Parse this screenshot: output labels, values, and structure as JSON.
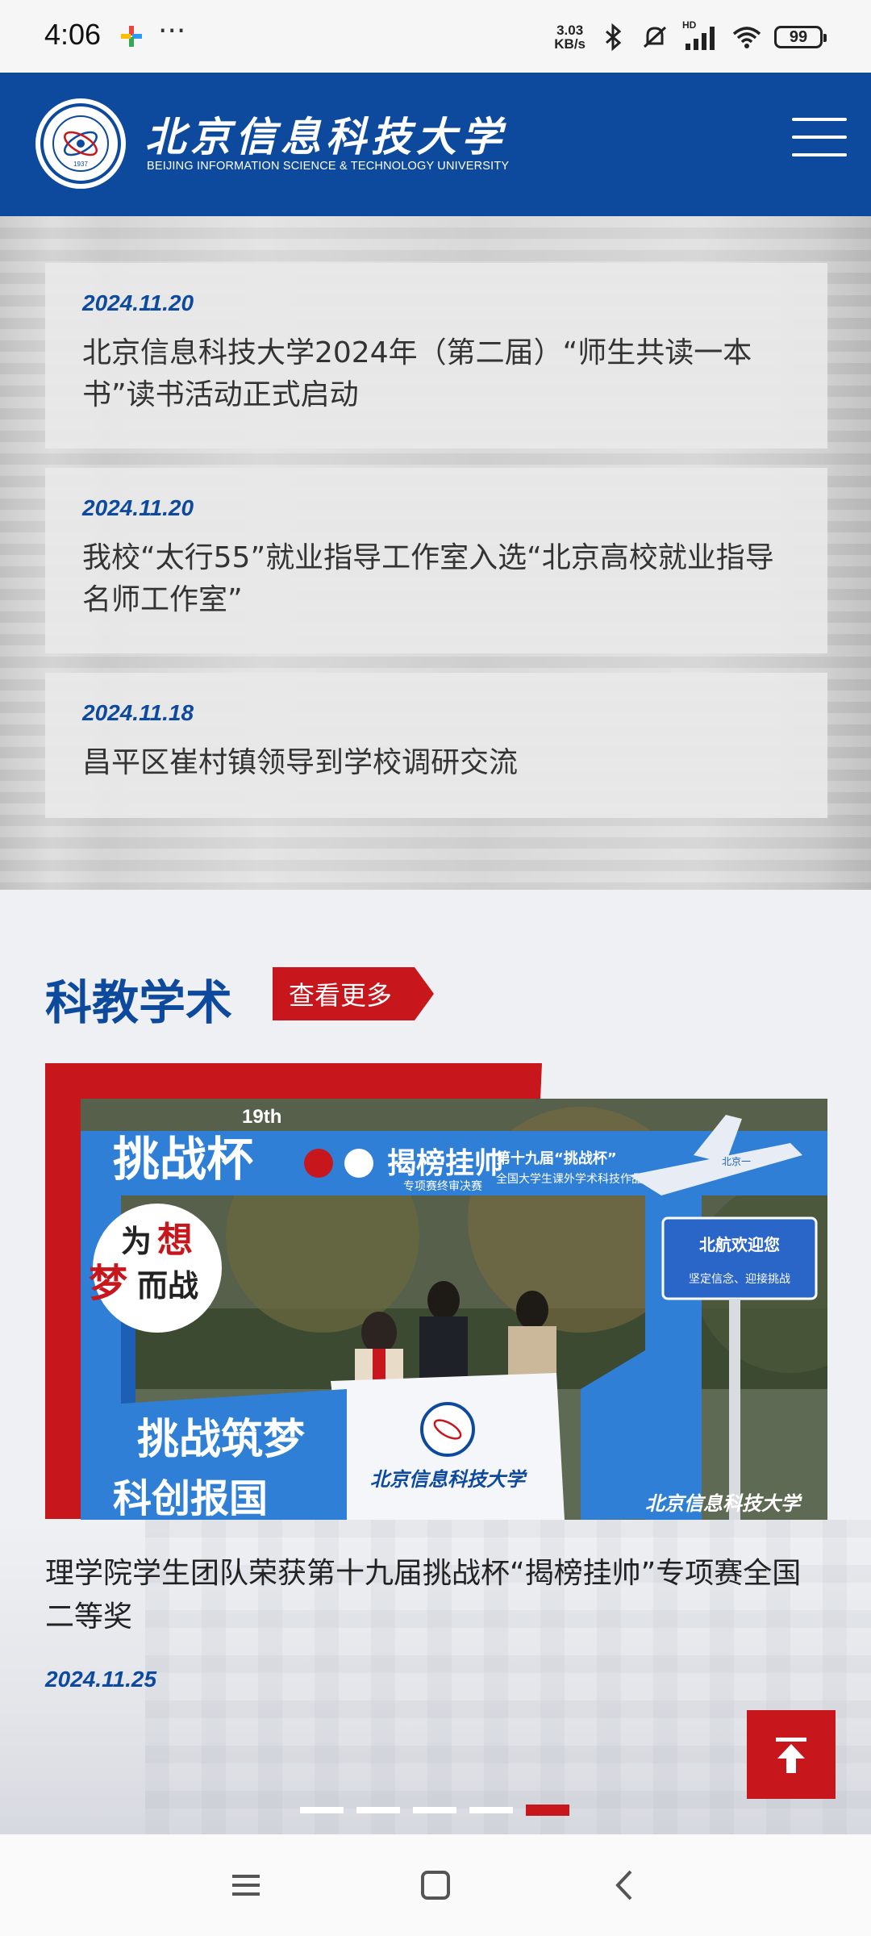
{
  "status_bar": {
    "time": "4:06",
    "dots": "···",
    "net_speed_value": "3.03",
    "net_speed_unit": "KB/s",
    "hd_label": "HD",
    "battery": "99"
  },
  "header": {
    "school_name_cn": "北京信息科技大学",
    "school_name_en": "BEIJING INFORMATION SCIENCE & TECHNOLOGY UNIVERSITY",
    "seal_year": "1937"
  },
  "news": [
    {
      "date": "2024.11.20",
      "title": "北京信息科技大学2024年（第二届）“师生共读一本书”读书活动正式启动"
    },
    {
      "date": "2024.11.20",
      "title": "我校“太行55”就业指导工作室入选“北京高校就业指导名师工作室”"
    },
    {
      "date": "2024.11.18",
      "title": "昌平区崔村镇领导到学校调研交流"
    }
  ],
  "section": {
    "title": "科教学术",
    "more_label": "查看更多"
  },
  "featured": {
    "title": "理学院学生团队荣获第十九届挑战杯“揭榜挂帅”专项赛全国二等奖",
    "date": "2024.11.25",
    "photo_texts": {
      "tzb": "挑战杯",
      "num": "19th",
      "jbgs": "揭榜挂帅",
      "jbgs_sub": "专项赛终审决赛",
      "comp": "第十九届“挑战杯”",
      "comp_sub": "全国大学生课外学术科技作品竞赛",
      "welcome": "北航欢迎您",
      "slogan": "坚定信念、迎接挑战",
      "dream1": "为",
      "dream2": "想",
      "dream3": "梦",
      "dream4": "而战",
      "banner_lower": "挑战筑梦",
      "banner_lower2": "科创报国",
      "flag": "北京信息科技大学",
      "watermark": "北京信息科技大学",
      "plane": "北京一"
    },
    "active_slide": 5,
    "total_slides": 5
  },
  "colors": {
    "brand_blue": "#0d4a9e",
    "brand_red": "#c8161d"
  }
}
